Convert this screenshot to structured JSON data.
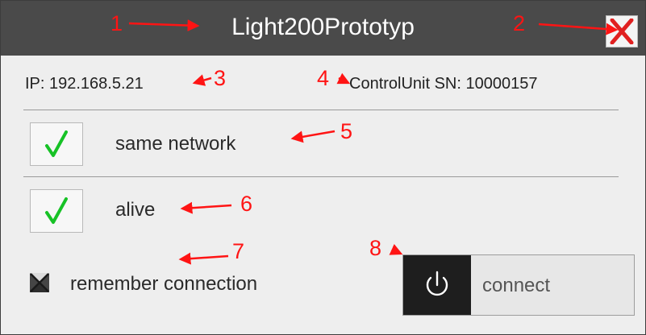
{
  "window": {
    "title": "Light200Prototyp",
    "close_icon": "close-x-icon"
  },
  "info": {
    "ip": "IP: 192.168.5.21",
    "control_unit_sn": "ControlUnit SN: 10000157"
  },
  "status": [
    {
      "label": "same network",
      "checked": true,
      "icon": "checkmark-icon"
    },
    {
      "label": "alive",
      "checked": true,
      "icon": "checkmark-icon"
    }
  ],
  "remember": {
    "label": "remember connection",
    "icon": "crossed-box-icon"
  },
  "connect": {
    "label": "connect",
    "icon": "power-icon"
  },
  "annotations": [
    "1",
    "2",
    "3",
    "4",
    "5",
    "6",
    "7",
    "8"
  ],
  "colors": {
    "titlebar": "#4a4a4a",
    "dialog_bg": "#eeeeee",
    "check_green": "#17c226",
    "close_red": "#e02020",
    "annotation_red": "#ff1414"
  }
}
